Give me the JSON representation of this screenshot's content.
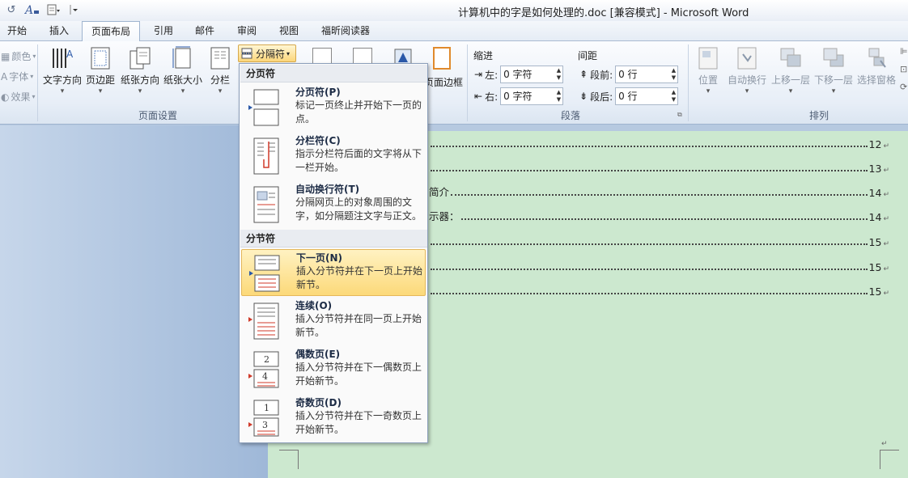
{
  "title_bar": {
    "title": "计算机中的字是如何处理的.doc [兼容模式] - Microsoft Word"
  },
  "quick_access": [
    "undo-icon",
    "font-color-icon",
    "new-doc-icon",
    "customize-icon"
  ],
  "tabs": [
    {
      "label": "开始"
    },
    {
      "label": "插入"
    },
    {
      "label": "页面布局"
    },
    {
      "label": "引用"
    },
    {
      "label": "邮件"
    },
    {
      "label": "审阅"
    },
    {
      "label": "视图"
    },
    {
      "label": "福昕阅读器"
    }
  ],
  "ribbon": {
    "theme_items": [
      {
        "label": "颜色",
        "icon": "color-icon"
      },
      {
        "label": "字体",
        "icon": "font-icon"
      },
      {
        "label": "效果",
        "icon": "effects-icon"
      }
    ],
    "page_setup": {
      "group_label": "页面设置",
      "buttons": [
        "文字方向",
        "页边距",
        "纸张方向",
        "纸张大小",
        "分栏"
      ],
      "breaks_button": "分隔符"
    },
    "paragraph": {
      "group_label": "段落",
      "indent_title": "缩进",
      "spacing_title": "间距",
      "left_label": "左:",
      "right_label": "右:",
      "left_value": "0 字符",
      "right_value": "0 字符",
      "before_label": "段前:",
      "after_label": "段后:",
      "before_value": "0 行",
      "after_value": "0 行"
    },
    "partial_background": "页面边框",
    "arrange": {
      "group_label": "排列",
      "buttons": [
        "位置",
        "自动换行",
        "上移一层",
        "下移一层",
        "选择窗格"
      ]
    }
  },
  "dropdown": {
    "section_page_breaks": "分页符",
    "section_section_breaks": "分节符",
    "items": [
      {
        "title": "分页符(P)",
        "desc": "标记一页终止并开始下一页的点。"
      },
      {
        "title": "分栏符(C)",
        "desc": "指示分栏符后面的文字将从下一栏开始。"
      },
      {
        "title": "自动换行符(T)",
        "desc": "分隔网页上的对象周围的文字，如分隔题注文字与正文。"
      },
      {
        "title": "下一页(N)",
        "desc": "插入分节符并在下一页上开始新节。"
      },
      {
        "title": "连续(O)",
        "desc": "插入分节符并在同一页上开始新节。"
      },
      {
        "title": "偶数页(E)",
        "desc": "插入分节符并在下一偶数页上开始新节。"
      },
      {
        "title": "奇数页(D)",
        "desc": "插入分节符并在下一奇数页上开始新节。"
      }
    ]
  },
  "toc": [
    {
      "text": "",
      "page": "12"
    },
    {
      "text": "",
      "page": "13"
    },
    {
      "text": "简介",
      "page": "14"
    },
    {
      "text": "示器：",
      "page": "14"
    },
    {
      "text": "",
      "page": "15"
    },
    {
      "text": "",
      "page": "15"
    },
    {
      "text": "",
      "page": "15"
    }
  ],
  "colors": {
    "page_bg": "#cce8cf",
    "highlight": "#fcd979",
    "ribbon": "#e7eef7"
  }
}
